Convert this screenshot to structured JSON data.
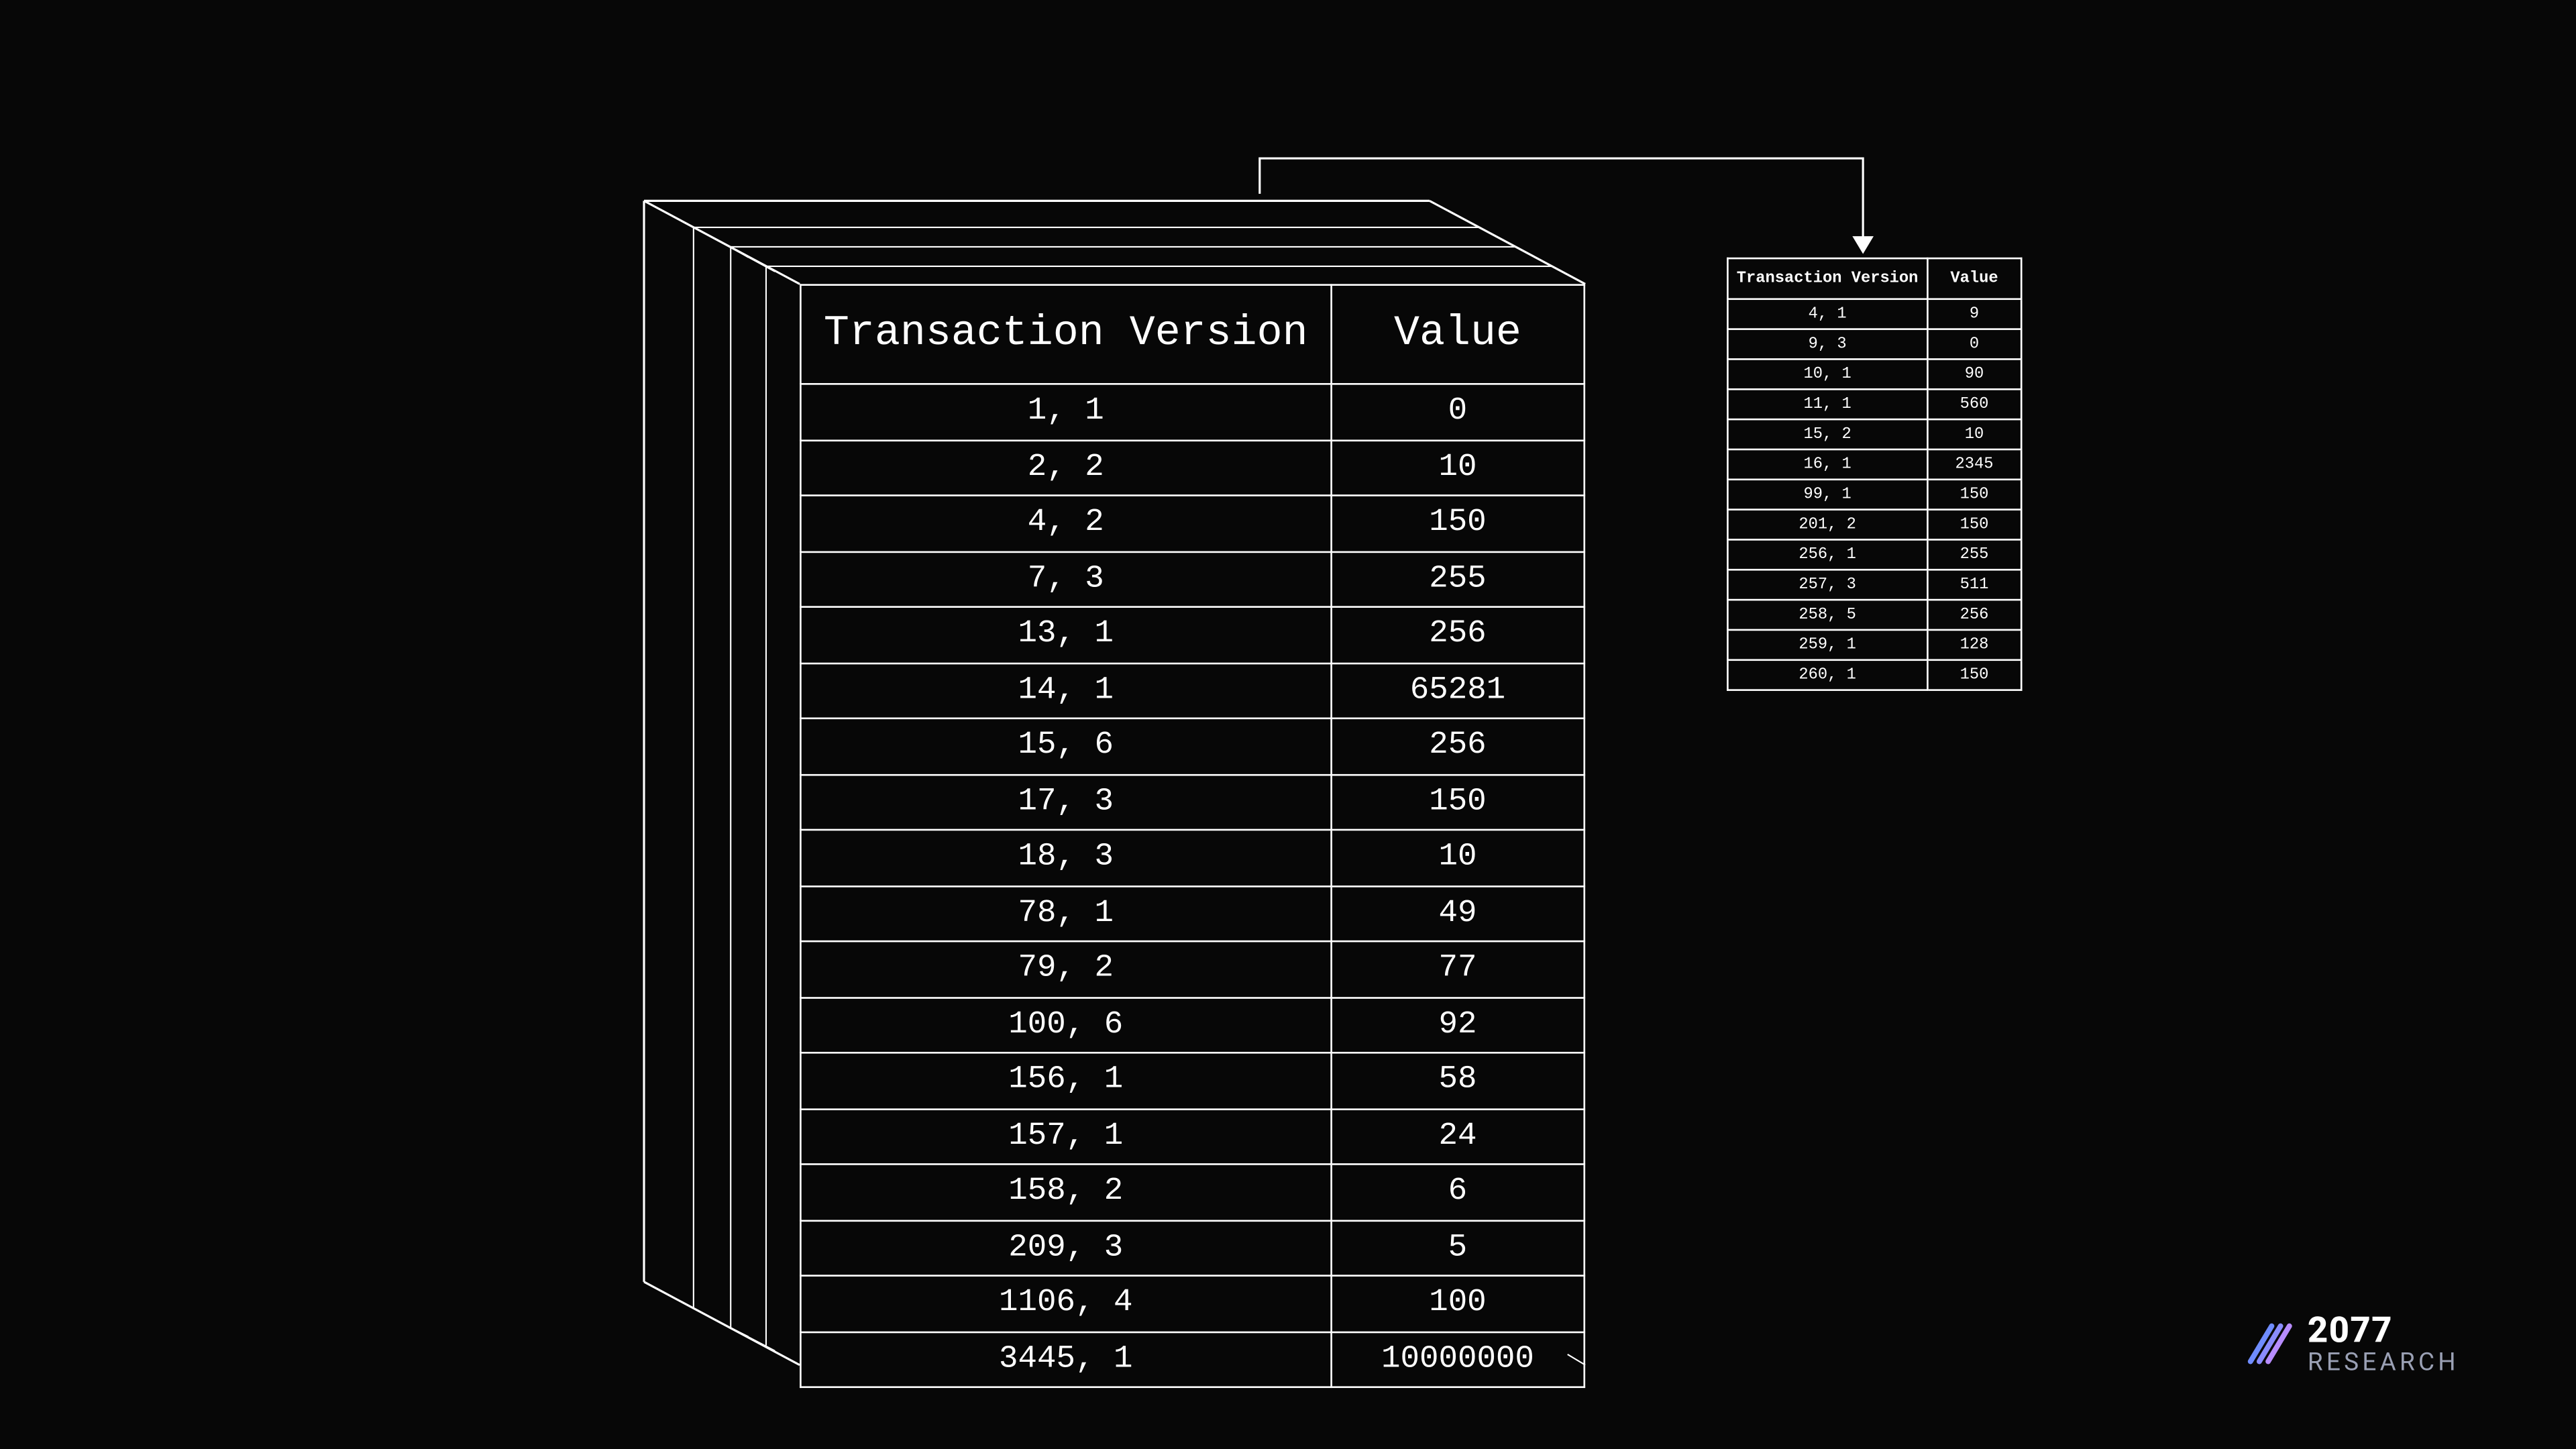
{
  "main_table": {
    "headers": {
      "tv": "Transaction Version",
      "value": "Value"
    },
    "rows": [
      {
        "tv": "1, 1",
        "value": "0"
      },
      {
        "tv": "2, 2",
        "value": "10"
      },
      {
        "tv": "4, 2",
        "value": "150"
      },
      {
        "tv": "7, 3",
        "value": "255"
      },
      {
        "tv": "13, 1",
        "value": "256"
      },
      {
        "tv": "14, 1",
        "value": "65281"
      },
      {
        "tv": "15, 6",
        "value": "256"
      },
      {
        "tv": "17, 3",
        "value": "150"
      },
      {
        "tv": "18, 3",
        "value": "10"
      },
      {
        "tv": "78, 1",
        "value": "49"
      },
      {
        "tv": "79, 2",
        "value": "77"
      },
      {
        "tv": "100, 6",
        "value": "92"
      },
      {
        "tv": "156, 1",
        "value": "58"
      },
      {
        "tv": "157, 1",
        "value": "24"
      },
      {
        "tv": "158, 2",
        "value": "6"
      },
      {
        "tv": "209, 3",
        "value": "5"
      },
      {
        "tv": "1106, 4",
        "value": "100"
      },
      {
        "tv": "3445, 1",
        "value": "10000000"
      }
    ]
  },
  "small_table": {
    "headers": {
      "tv": "Transaction Version",
      "value": "Value"
    },
    "rows": [
      {
        "tv": "4, 1",
        "value": "9"
      },
      {
        "tv": "9, 3",
        "value": "0"
      },
      {
        "tv": "10, 1",
        "value": "90"
      },
      {
        "tv": "11, 1",
        "value": "560"
      },
      {
        "tv": "15, 2",
        "value": "10"
      },
      {
        "tv": "16, 1",
        "value": "2345"
      },
      {
        "tv": "99, 1",
        "value": "150"
      },
      {
        "tv": "201, 2",
        "value": "150"
      },
      {
        "tv": "256, 1",
        "value": "255"
      },
      {
        "tv": "257, 3",
        "value": "511"
      },
      {
        "tv": "258, 5",
        "value": "256"
      },
      {
        "tv": "259, 1",
        "value": "128"
      },
      {
        "tv": "260, 1",
        "value": "150"
      }
    ]
  },
  "logo": {
    "year": "2077",
    "word": "RESEARCH"
  },
  "colors": {
    "bg": "#070707",
    "line": "#ffffff",
    "logo_accent_a": "#6f8cff",
    "logo_accent_b": "#b78cff"
  }
}
